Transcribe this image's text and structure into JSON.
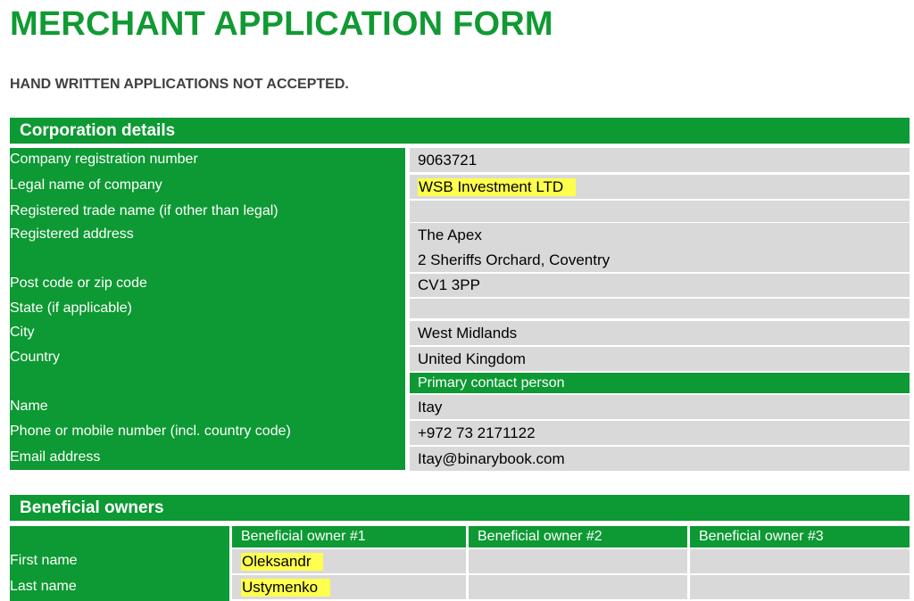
{
  "title": "MERCHANT APPLICATION FORM",
  "notice": "HAND WRITTEN APPLICATIONS NOT ACCEPTED.",
  "corporation": {
    "heading": "Corporation details",
    "rows": [
      {
        "label": "Company registration number",
        "value": "9063721"
      },
      {
        "label": "Legal name of company",
        "value": "WSB Investment LTD"
      },
      {
        "label": "Registered trade name (if other than legal)",
        "value": ""
      },
      {
        "label": "Registered address",
        "value_lines": [
          "The Apex",
          "2 Sheriffs Orchard, Coventry"
        ]
      },
      {
        "label": "Post code or zip code",
        "value": "CV1 3PP"
      },
      {
        "label": "State (if applicable)",
        "value": ""
      },
      {
        "label": "City",
        "value": "West Midlands"
      },
      {
        "label": "Country",
        "value": "United Kingdom"
      }
    ],
    "contact_heading": "Primary contact person",
    "contact_rows": [
      {
        "label": "Name",
        "value": "Itay"
      },
      {
        "label": "Phone or mobile number (incl. country code)",
        "value": "+972 73 2171122"
      },
      {
        "label": "Email address",
        "value": "Itay@binarybook.com"
      }
    ]
  },
  "beneficial": {
    "heading": "Beneficial owners",
    "columns": [
      "Beneficial owner #1",
      "Beneficial owner #2",
      "Beneficial owner #3"
    ],
    "rows": [
      {
        "label": "First name",
        "values": [
          "Oleksandr",
          "",
          ""
        ]
      },
      {
        "label": "Last name",
        "values": [
          "Ustymenko",
          "",
          ""
        ]
      }
    ]
  },
  "colors": {
    "brand_green": "#0d9933",
    "title_green": "#119a33",
    "field_gray": "#d9d9d9",
    "highlight": "#ffff4d"
  }
}
